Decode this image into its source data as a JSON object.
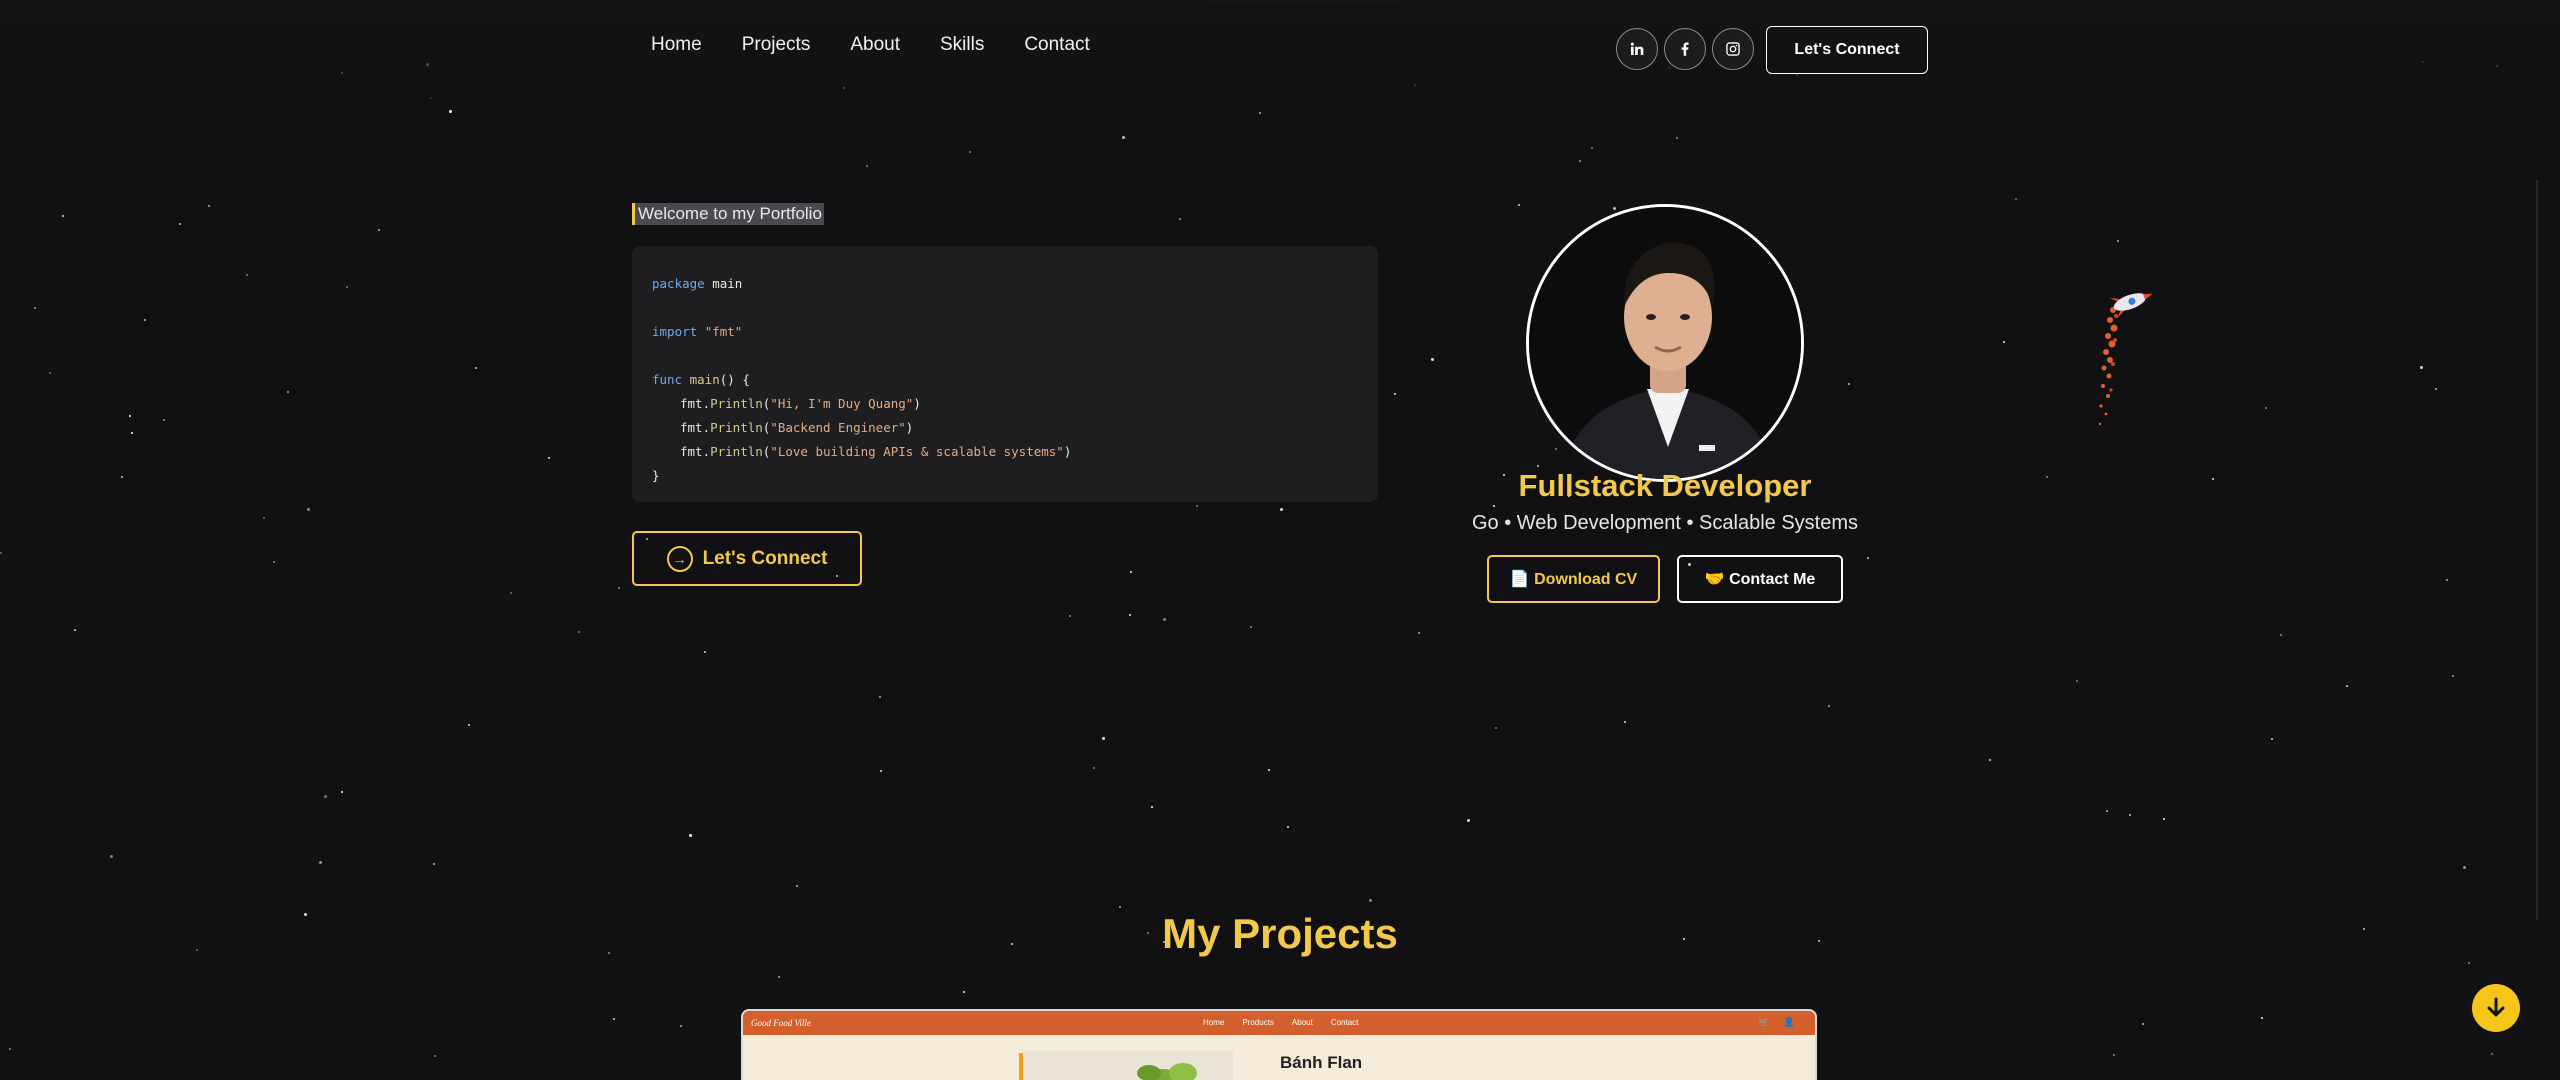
{
  "nav": {
    "links": [
      "Home",
      "Projects",
      "About",
      "Skills",
      "Contact"
    ],
    "socials": [
      "linkedin-icon",
      "facebook-icon",
      "instagram-icon"
    ],
    "connect_label": "Let's Connect"
  },
  "hero": {
    "welcome": "Welcome to my Portfolio",
    "code": {
      "line1_kw": "package",
      "line1_rest": " main",
      "line3_kw": "import",
      "line3_str": "\"fmt\"",
      "line5_kw": "func",
      "line5_fn": " main",
      "line5_rest": "() {",
      "obj": "fmt.",
      "method": "Println",
      "str1": "\"Hi, I'm Duy Quang\"",
      "str2": "\"Backend Engineer\"",
      "str3": "\"Love building APIs & scalable systems\"",
      "close": "}"
    },
    "connect_label": "Let's Connect",
    "connect_icon": "arrow-right-circle-icon"
  },
  "profile": {
    "title": "Fullstack Developer",
    "subtitle": "Go • Web Development • Scalable Systems",
    "download_label": "📄 Download CV",
    "contact_label": "🤝 Contact Me"
  },
  "projects": {
    "heading": "My Projects",
    "preview": {
      "brand": "Good Food Ville",
      "links": [
        "Home",
        "Products",
        "About",
        "Contact"
      ],
      "item_name": "Bánh Flan"
    }
  },
  "colors": {
    "accent": "#f2c94c",
    "background": "#111113",
    "preview_nav": "#d35f2c"
  }
}
